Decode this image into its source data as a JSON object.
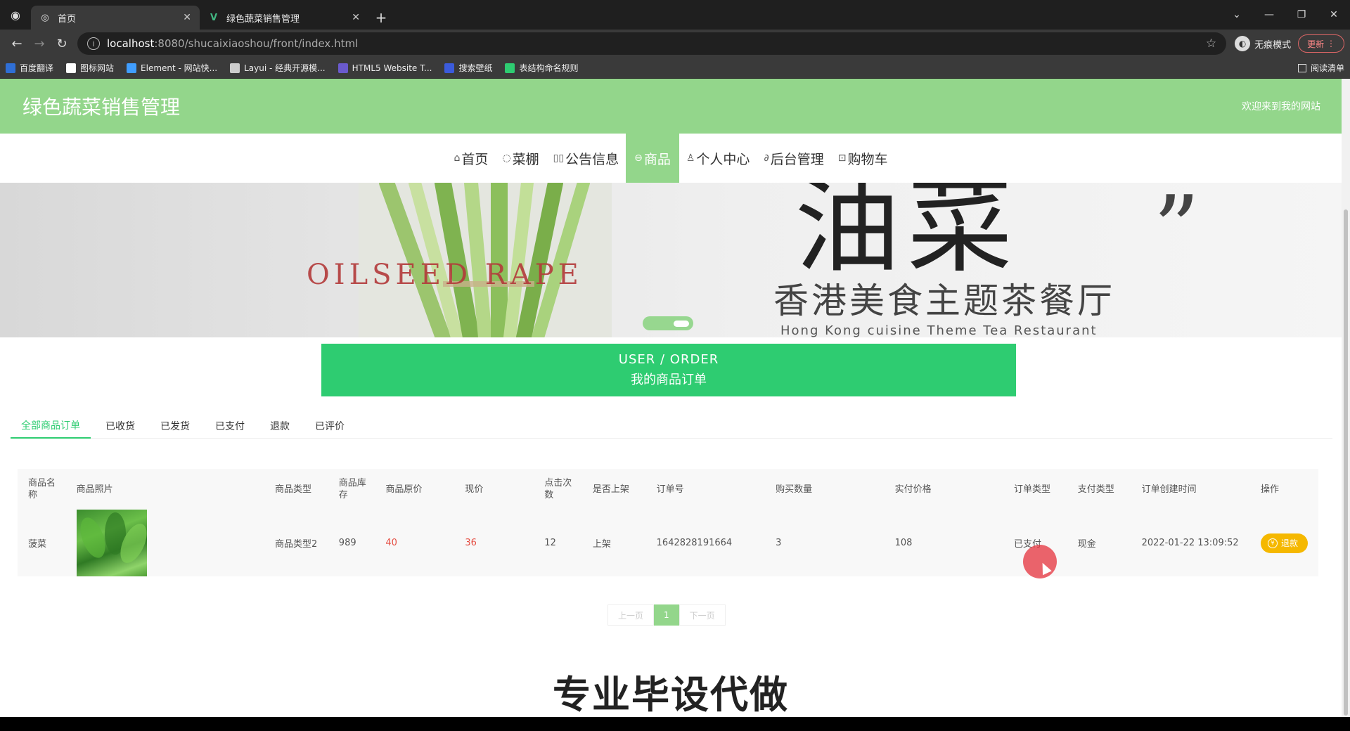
{
  "browser": {
    "tabs": [
      {
        "title": "首页",
        "active": true
      },
      {
        "title": "绿色蔬菜销售管理",
        "active": false
      }
    ],
    "url_host": "localhost",
    "url_path": ":8080/shucaixiaoshou/front/index.html",
    "incognito_label": "无痕模式",
    "update_label": "更新",
    "bookmarks": [
      {
        "label": "百度翻译",
        "color": "#2f6fd6"
      },
      {
        "label": "图标网站",
        "color": "#ffffff"
      },
      {
        "label": "Element - 网站快...",
        "color": "#409eff"
      },
      {
        "label": "Layui - 经典开源模...",
        "color": "#cccccc"
      },
      {
        "label": "HTML5 Website T...",
        "color": "#6a5acd"
      },
      {
        "label": "搜索壁纸",
        "color": "#3b5bdb"
      },
      {
        "label": "表结构命名规则",
        "color": "#2ecc71"
      }
    ],
    "reading_list_label": "阅读清单"
  },
  "site": {
    "title": "绿色蔬菜销售管理",
    "welcome": "欢迎来到我的网站",
    "nav": [
      {
        "label": "首页",
        "icon": "home-icon",
        "glyph": "⌂"
      },
      {
        "label": "菜棚",
        "icon": "palette-icon",
        "glyph": "◌"
      },
      {
        "label": "公告信息",
        "icon": "book-icon",
        "glyph": "▯▯"
      },
      {
        "label": "商品",
        "icon": "goods-icon",
        "glyph": "⊖",
        "active": true
      },
      {
        "label": "个人中心",
        "icon": "user-icon",
        "glyph": "♙"
      },
      {
        "label": "后台管理",
        "icon": "link-icon",
        "glyph": "∂"
      },
      {
        "label": "购物车",
        "icon": "cart-icon",
        "glyph": "⊡"
      }
    ]
  },
  "banner": {
    "oilseed_text": "OILSEED RAPE",
    "big_char": "油菜",
    "restaurant_text": "香港美食主题茶餐厅",
    "restaurant_en": "Hong Kong cuisine Theme Tea Restaurant"
  },
  "order_banner": {
    "en": "USER / ORDER",
    "cn": "我的商品订单"
  },
  "filter_tabs": [
    "全部商品订单",
    "已收货",
    "已发货",
    "已支付",
    "退款",
    "已评价"
  ],
  "table": {
    "headers": [
      "商品名称",
      "商品照片",
      "商品类型",
      "商品库存",
      "商品原价",
      "现价",
      "点击次数",
      "是否上架",
      "订单号",
      "购买数量",
      "实付价格",
      "订单类型",
      "支付类型",
      "订单创建时间",
      "操作"
    ],
    "rows": [
      {
        "name": "菠菜",
        "type": "商品类型2",
        "stock": "989",
        "orig_price": "40",
        "price": "36",
        "clicks": "12",
        "listed": "上架",
        "order_no": "1642828191664",
        "qty": "3",
        "paid": "108",
        "order_type": "已支付",
        "pay_type": "现金",
        "created": "2022-01-22 13:09:52",
        "action": "退款"
      }
    ]
  },
  "pagination": {
    "prev": "上一页",
    "current": "1",
    "next": "下一页"
  },
  "watermark": "专业毕设代做"
}
